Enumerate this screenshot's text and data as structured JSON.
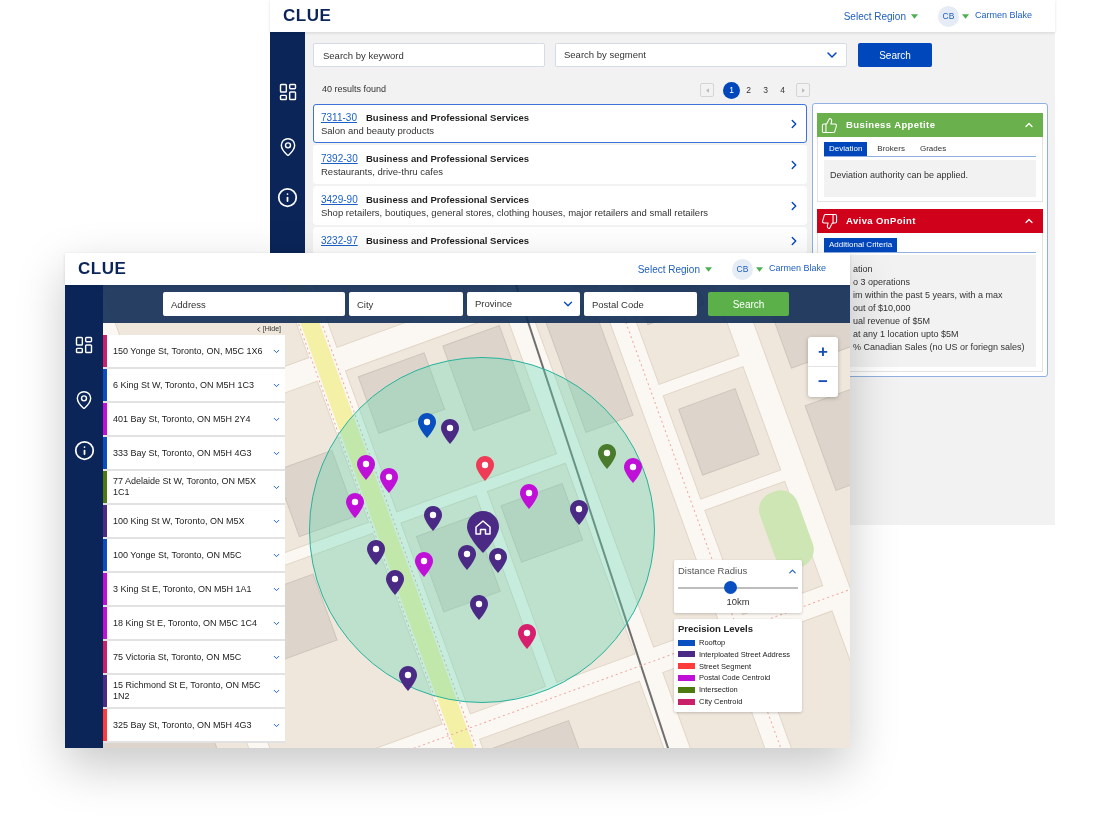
{
  "back_window": {
    "header": {
      "logo": "CLUE",
      "region_select": "Select Region",
      "avatar": "CB",
      "user_name": "Carmen Blake"
    },
    "search": {
      "keyword_placeholder": "Search by keyword",
      "segment_placeholder": "Search by segment",
      "button": "Search"
    },
    "results_count": "40 results found",
    "pages": [
      {
        "label": "1",
        "selected": true
      },
      {
        "label": "2",
        "selected": false
      },
      {
        "label": "3",
        "selected": false
      },
      {
        "label": "4",
        "selected": false
      }
    ],
    "results": [
      {
        "code": "7311-30",
        "title": "Business and Professional Services",
        "description": "Salon and beauty products",
        "selected": true
      },
      {
        "code": "7392-30",
        "title": "Business and Professional Services",
        "description": "Restaurants, drive-thru cafes",
        "selected": false
      },
      {
        "code": "3429-90",
        "title": "Business and Professional Services",
        "description": "Shop retailers, boutiques, general stores, clothing houses, major retailers and small retailers",
        "selected": false
      },
      {
        "code": "3232-97",
        "title": "Business and Professional Services",
        "selected": false
      }
    ],
    "panels": [
      {
        "kind": "positive",
        "title": "Business Appetite",
        "expanded": true,
        "tabs": [
          {
            "label": "Deviation",
            "selected": true
          },
          {
            "label": "Brokers",
            "selected": false
          },
          {
            "label": "Grades",
            "selected": false
          }
        ],
        "text": "Deviation authority can be applied."
      },
      {
        "kind": "negative",
        "title": "Aviva OnPoint",
        "expanded": true,
        "tabs": [
          {
            "label": "Additional Criteria",
            "selected": true
          }
        ],
        "criteria": [
          "ation",
          "o 3 operations",
          "im within the past 5 years, with a max",
          "out of $10,000",
          "ual revenue of $5M",
          "at any 1 location upto $5M",
          "% Canadian Sales (no US or foriegn sales)"
        ]
      }
    ]
  },
  "front_window": {
    "header": {
      "logo": "CLUE",
      "region_select": "Select Region",
      "avatar": "CB",
      "user_name": "Carmen Blake"
    },
    "search": {
      "fields": [
        {
          "kind": "input",
          "placeholder": "Address"
        },
        {
          "kind": "input",
          "placeholder": "City"
        },
        {
          "kind": "select",
          "placeholder": "Province"
        },
        {
          "kind": "input",
          "placeholder": "Postal Code"
        }
      ],
      "button": "Search"
    },
    "list": {
      "hide_label": "[Hide]",
      "items": [
        {
          "address": "150 Yonge St, Toronto, ON, M5C 1X6",
          "color": "#c8206a"
        },
        {
          "address": "6 King St W, Toronto, ON M5H 1C3",
          "color": "#0a4fc0"
        },
        {
          "address": "401 Bay St, Toronto, ON M5H 2Y4",
          "color": "#c010d8"
        },
        {
          "address": "333 Bay St, Toronto, ON M5H 4G3",
          "color": "#0a4fc0"
        },
        {
          "address": "77 Adelaide St W, Toronto, ON M5X 1C1",
          "color": "#4a7a10"
        },
        {
          "address": "100 King St W, Toronto, ON M5X",
          "color": "#4a2a85"
        },
        {
          "address": "100 Yonge St, Toronto, ON M5C",
          "color": "#0a4fc0"
        },
        {
          "address": "3 King St E, Toronto, ON M5H 1A1",
          "color": "#c010d8"
        },
        {
          "address": "18 King St E, Toronto, ON M5C 1C4",
          "color": "#c010d8"
        },
        {
          "address": "75 Victoria St, Toronto, ON M5C",
          "color": "#c8206a"
        },
        {
          "address": "15 Richmond St E, Toronto, ON M5C 1N2",
          "color": "#4a2a85"
        },
        {
          "address": "325 Bay St, Toronto, ON M5H 4G3",
          "color": "#ff3b3b"
        }
      ]
    },
    "map": {
      "zoom_in": "+",
      "zoom_out": "−",
      "markers": [
        {
          "kind": "pin",
          "color": "#0a4fc0"
        },
        {
          "kind": "pin",
          "color": "#4a2a85"
        },
        {
          "kind": "pin",
          "color": "#c010d8"
        },
        {
          "kind": "pin",
          "color": "#c010d8"
        },
        {
          "kind": "pin",
          "color": "#c010d8"
        },
        {
          "kind": "pin",
          "color": "#ef3b55"
        },
        {
          "kind": "pin",
          "color": "#4a7a2c"
        },
        {
          "kind": "pin",
          "color": "#c010d8"
        },
        {
          "kind": "pin",
          "color": "#c010d8"
        },
        {
          "kind": "pin",
          "color": "#4a2a85"
        },
        {
          "kind": "pin",
          "color": "#4a2a85"
        },
        {
          "kind": "home",
          "color": "#4a2a85"
        },
        {
          "kind": "pin",
          "color": "#4a2a85"
        },
        {
          "kind": "pin",
          "color": "#c010d8"
        },
        {
          "kind": "pin",
          "color": "#4a2a85"
        },
        {
          "kind": "pin",
          "color": "#4a2a85"
        },
        {
          "kind": "pin",
          "color": "#4a2a85"
        },
        {
          "kind": "pin",
          "color": "#4a2a85"
        },
        {
          "kind": "pin",
          "color": "#d81f6e"
        },
        {
          "kind": "pin",
          "color": "#4a2a85"
        }
      ],
      "distance_radius": {
        "title": "Distance Radius",
        "expanded": true,
        "level": 0.44,
        "reading": "10km"
      },
      "legend": {
        "title": "Precision Levels",
        "items": [
          {
            "label": "Rooftop",
            "color": "#0a4fc0"
          },
          {
            "label": "Interploated Street Address",
            "color": "#4a2a85"
          },
          {
            "label": "Street Segment",
            "color": "#ff3b3b"
          },
          {
            "label": "Postal Code Centroid",
            "color": "#c010d8"
          },
          {
            "label": "Intersection",
            "color": "#4a7a10"
          },
          {
            "label": "City Centroid",
            "color": "#c8206a"
          }
        ]
      }
    }
  }
}
